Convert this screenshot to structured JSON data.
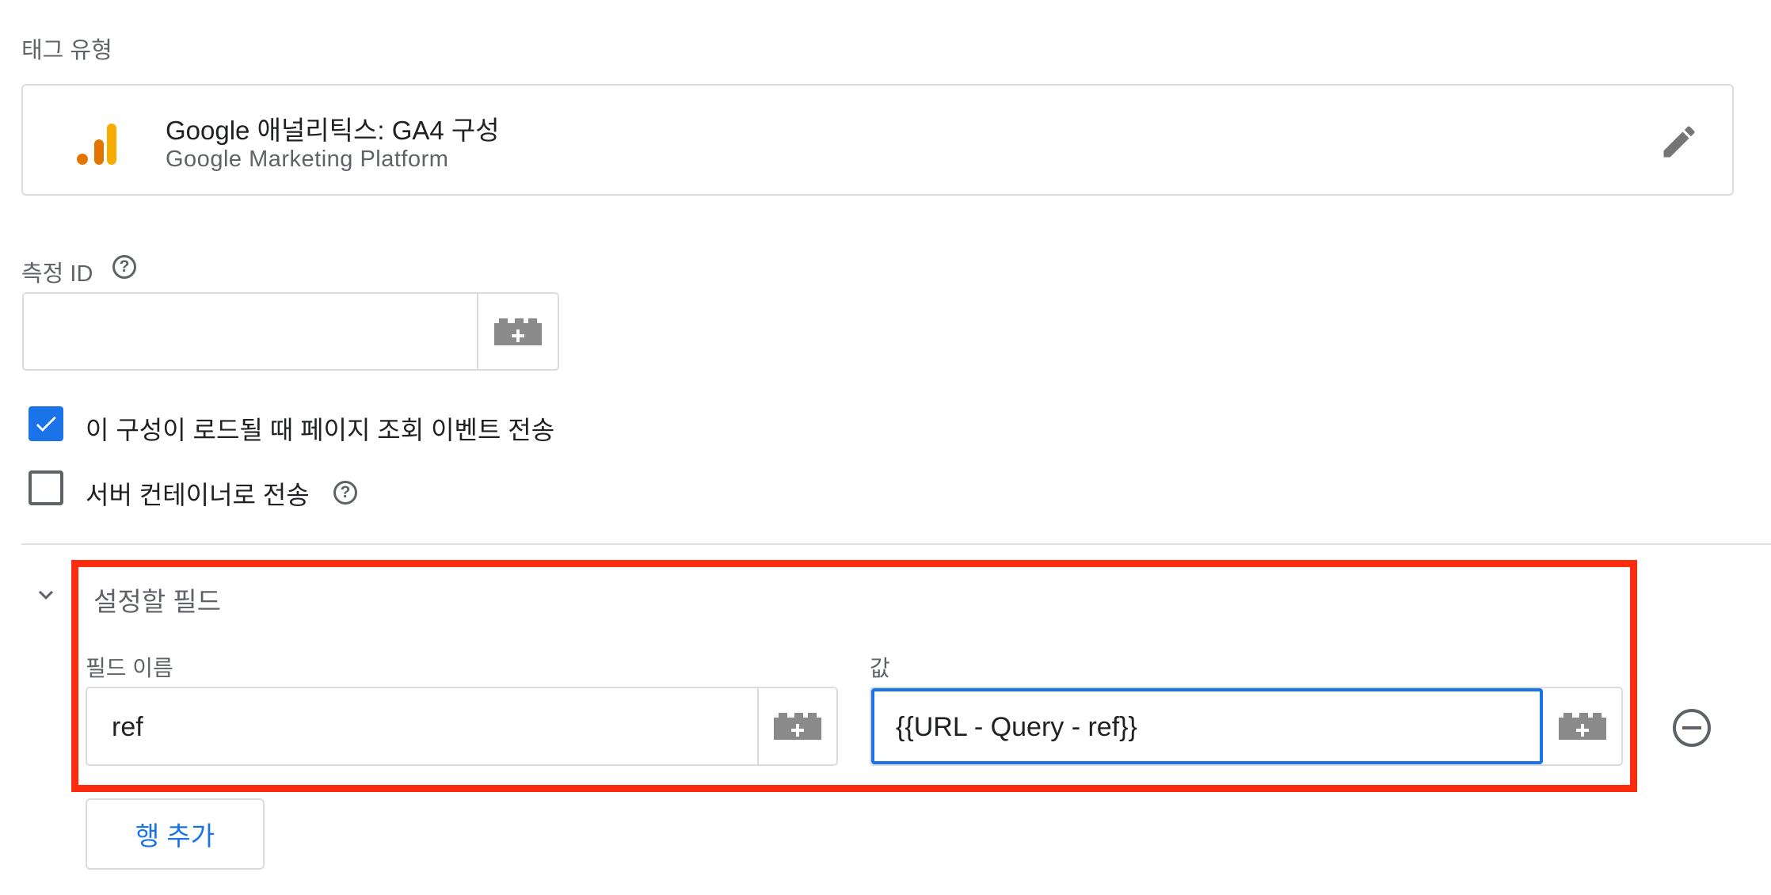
{
  "tag_type": {
    "section_label": "태그 유형",
    "title": "Google 애널리틱스: GA4 구성",
    "subtitle": "Google Marketing Platform",
    "logo_icon": "google-analytics-logo",
    "edit_icon": "pencil-icon"
  },
  "measurement_id": {
    "label": "측정 ID",
    "value": "",
    "help_icon": "help-circle-icon",
    "variable_icon": "add-variable-icon"
  },
  "options": [
    {
      "label": "이 구성이 로드될 때 페이지 조회 이벤트 전송",
      "checked": true
    },
    {
      "label": "서버 컨테이너로 전송",
      "checked": false,
      "has_help": true
    }
  ],
  "fields_to_set": {
    "section_title": "설정할 필드",
    "expand_icon": "chevron-down-icon",
    "field_name_label": "필드 이름",
    "value_label": "값",
    "rows": [
      {
        "field_name": "ref",
        "value": "{{URL - Query - ref}}"
      }
    ],
    "remove_row_icon": "minus-circle-icon",
    "add_row_label": "행 추가"
  },
  "colors": {
    "accent": "#1a73e8",
    "highlight_border": "#ff2b0f",
    "ga_orange": "#e37400",
    "ga_yellow": "#f9ab00"
  }
}
